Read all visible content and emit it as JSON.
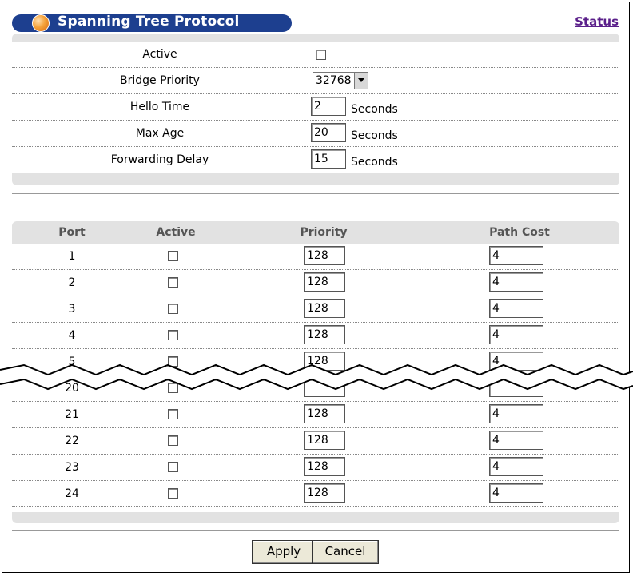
{
  "page": {
    "title": "Spanning Tree Protocol",
    "status_link": "Status"
  },
  "general": {
    "active_label": "Active",
    "active_checked": false,
    "bridge_priority_label": "Bridge Priority",
    "bridge_priority_value": "32768",
    "hello_time_label": "Hello Time",
    "hello_time_value": "2",
    "max_age_label": "Max Age",
    "max_age_value": "20",
    "forwarding_delay_label": "Forwarding Delay",
    "forwarding_delay_value": "15",
    "seconds_unit": "Seconds"
  },
  "ports_table": {
    "headers": {
      "port": "Port",
      "active": "Active",
      "priority": "Priority",
      "path_cost": "Path Cost"
    },
    "rows_top": [
      {
        "port": "1",
        "priority": "128",
        "path_cost": "4"
      },
      {
        "port": "2",
        "priority": "128",
        "path_cost": "4"
      },
      {
        "port": "3",
        "priority": "128",
        "path_cost": "4"
      },
      {
        "port": "4",
        "priority": "128",
        "path_cost": "4"
      },
      {
        "port": "5",
        "priority": "128",
        "path_cost": "4"
      }
    ],
    "row_break": {
      "port": "20"
    },
    "rows_bottom": [
      {
        "port": "21",
        "priority": "128",
        "path_cost": "4"
      },
      {
        "port": "22",
        "priority": "128",
        "path_cost": "4"
      },
      {
        "port": "23",
        "priority": "128",
        "path_cost": "4"
      },
      {
        "port": "24",
        "priority": "128",
        "path_cost": "4"
      }
    ]
  },
  "buttons": {
    "apply": "Apply",
    "cancel": "Cancel"
  },
  "colors": {
    "title_bar": "#1d3f8f",
    "status_link": "#5a1f8a",
    "panel_gray": "#e2e2e2"
  }
}
